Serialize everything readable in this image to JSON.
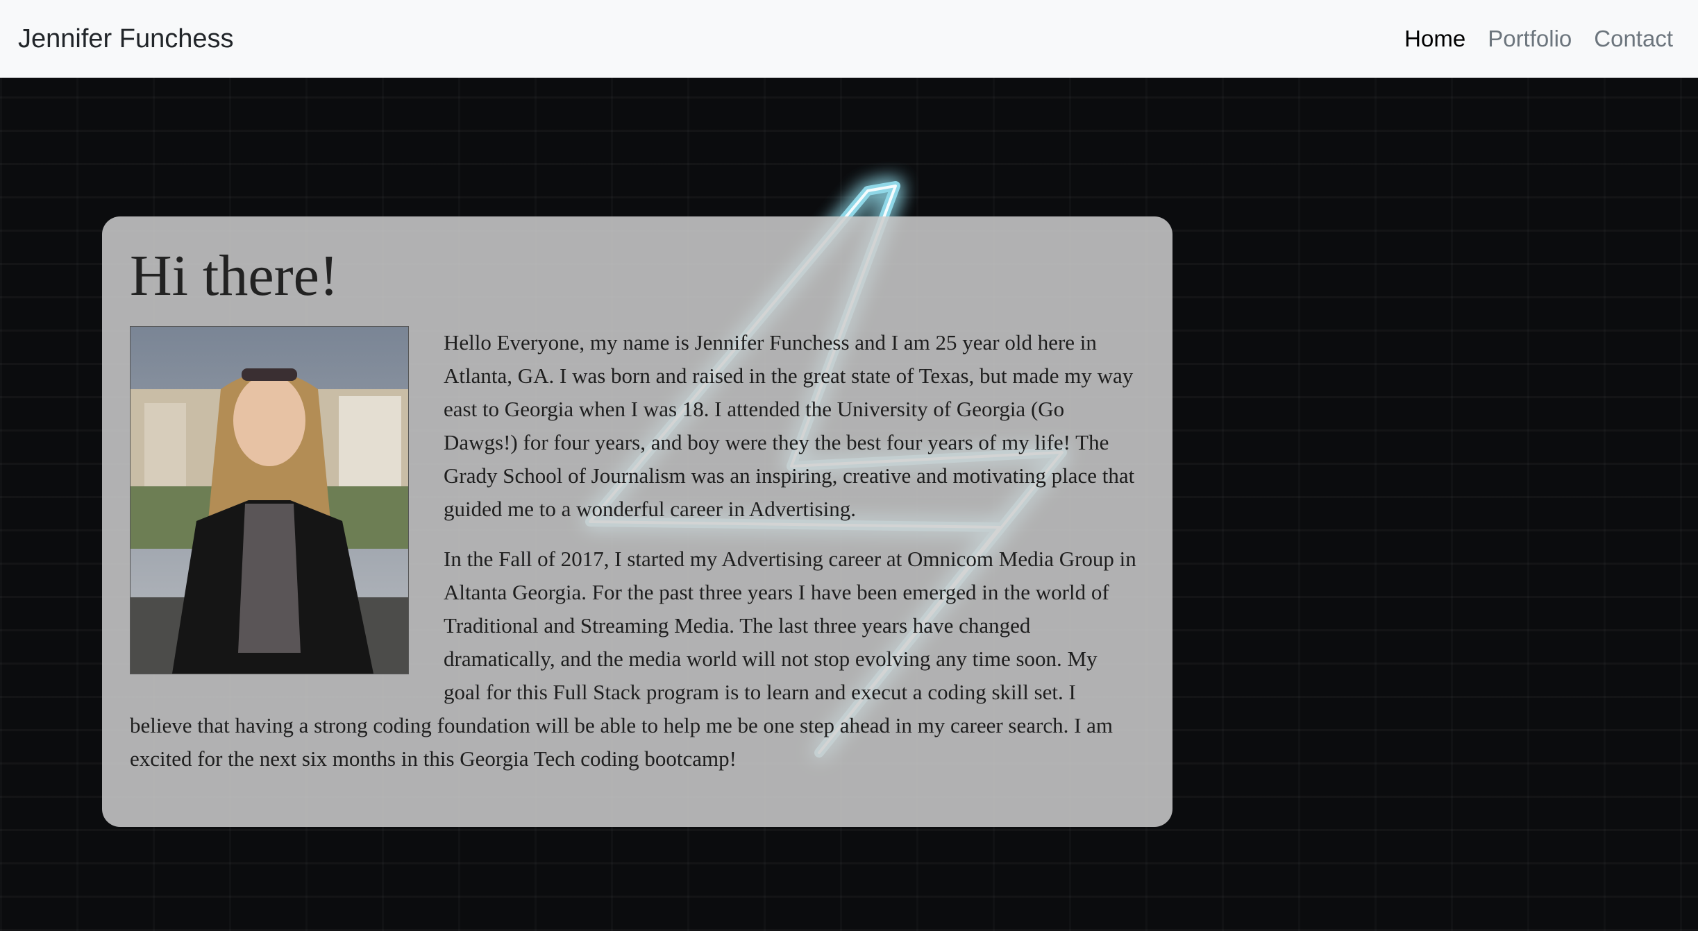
{
  "navbar": {
    "brand": "Jennifer Funchess",
    "links": [
      {
        "label": "Home",
        "active": true
      },
      {
        "label": "Portfolio",
        "active": false
      },
      {
        "label": "Contact",
        "active": false
      }
    ]
  },
  "card": {
    "heading": "Hi there!",
    "photo_alt": "Photo of Jennifer Funchess",
    "paragraphs": [
      "Hello Everyone, my name is Jennifer Funchess and I am 25 year old here in Atlanta, GA. I was born and raised in the great state of Texas, but made my way east to Georgia when I was 18. I attended the University of Georgia (Go Dawgs!) for four years, and boy were they the best four years of my life! The Grady School of Journalism was an inspiring, creative and motivating place that guided me to a wonderful career in Advertising.",
      "In the Fall of 2017, I started my Advertising career at Omnicom Media Group in Altanta Georgia. For the past three years I have been emerged in the world of Traditional and Streaming Media. The last three years have changed dramatically, and the media world will not stop evolving any time soon. My goal for this Full Stack program is to learn and execut a coding skill set. I believe that having a strong coding foundation will be able to help me be one step ahead in my career search. I am excited for the next six months in this Georgia Tech coding bootcamp!"
    ]
  },
  "colors": {
    "navbar_bg": "#f8f9fa",
    "nav_active": "#000000",
    "nav_inactive": "#6c757d",
    "neon": "#8fe9ff"
  }
}
